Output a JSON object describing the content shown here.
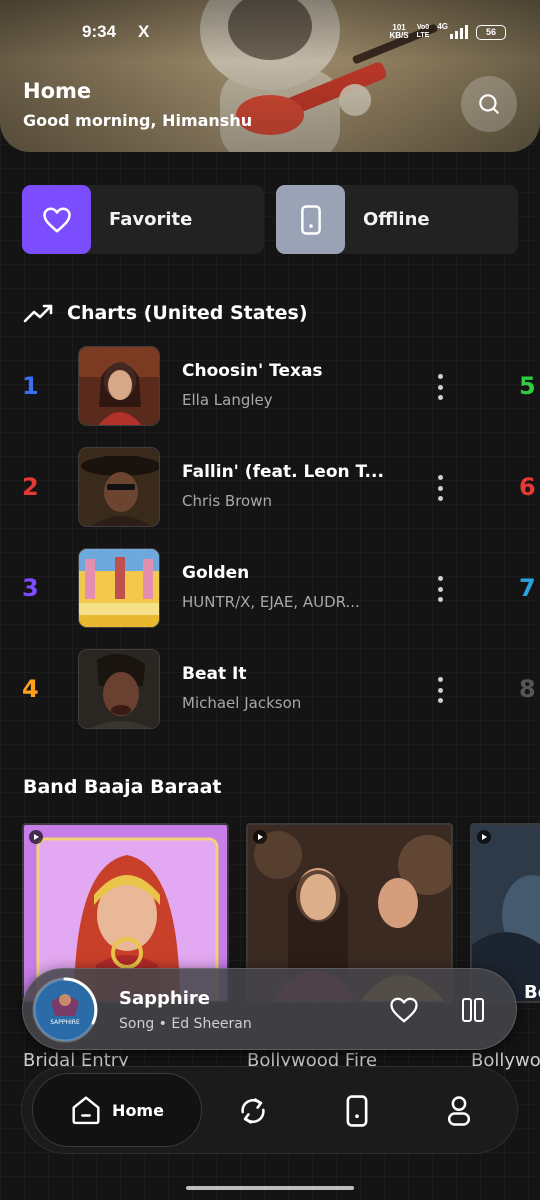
{
  "status_bar": {
    "time": "9:34",
    "x_glyph": "X",
    "net_speed_value": "101",
    "net_speed_unit": "KB/S",
    "volte_top": "Vo0",
    "volte_bottom": "LTE",
    "signal_label": "4G",
    "battery": "56"
  },
  "header": {
    "title": "Home",
    "greeting": "Good morning, Himanshu",
    "search_icon": "search-icon"
  },
  "quick_access": [
    {
      "label": "Favorite",
      "icon": "heart-icon",
      "color": "#7c4dff"
    },
    {
      "label": "Offline",
      "icon": "phone-icon",
      "color": "#9aa3b5"
    }
  ],
  "charts": {
    "title": "Charts (United States)",
    "icon": "trending-up-icon",
    "items": [
      {
        "rank": "1",
        "rank_color": "#3b6ef2",
        "title": "Choosin' Texas",
        "artist": "Ella Langley"
      },
      {
        "rank": "2",
        "rank_color": "#e53935",
        "title": "Fallin' (feat. Leon T...",
        "artist": "Chris Brown"
      },
      {
        "rank": "3",
        "rank_color": "#7c4dff",
        "title": "Golden",
        "artist": "HUNTR/X, EJAE, AUDR..."
      },
      {
        "rank": "4",
        "rank_color": "#ff9f1a",
        "title": "Beat It",
        "artist": "Michael Jackson"
      }
    ],
    "peek_ranks": [
      {
        "rank": "5",
        "color": "#2ecc40"
      },
      {
        "rank": "6",
        "color": "#e53935"
      },
      {
        "rank": "7",
        "color": "#29a3e0"
      },
      {
        "rank": "8",
        "color": "#555555"
      }
    ]
  },
  "playlist_section": {
    "title": "Band Baaja Baraat",
    "albums": [
      {
        "caption": "Bridal Entry"
      },
      {
        "caption": "Bollywood Fire"
      },
      {
        "caption": "Bollywo",
        "overlay_text": "Bo"
      }
    ]
  },
  "now_playing": {
    "title": "Sapphire",
    "subtitle": "Song • Ed Sheeran",
    "art_text": "SAPPHIRE",
    "progress": 0.3
  },
  "bottom_nav": {
    "home_label": "Home",
    "items": [
      "home-icon",
      "sync-icon",
      "device-icon",
      "profile-icon"
    ]
  }
}
